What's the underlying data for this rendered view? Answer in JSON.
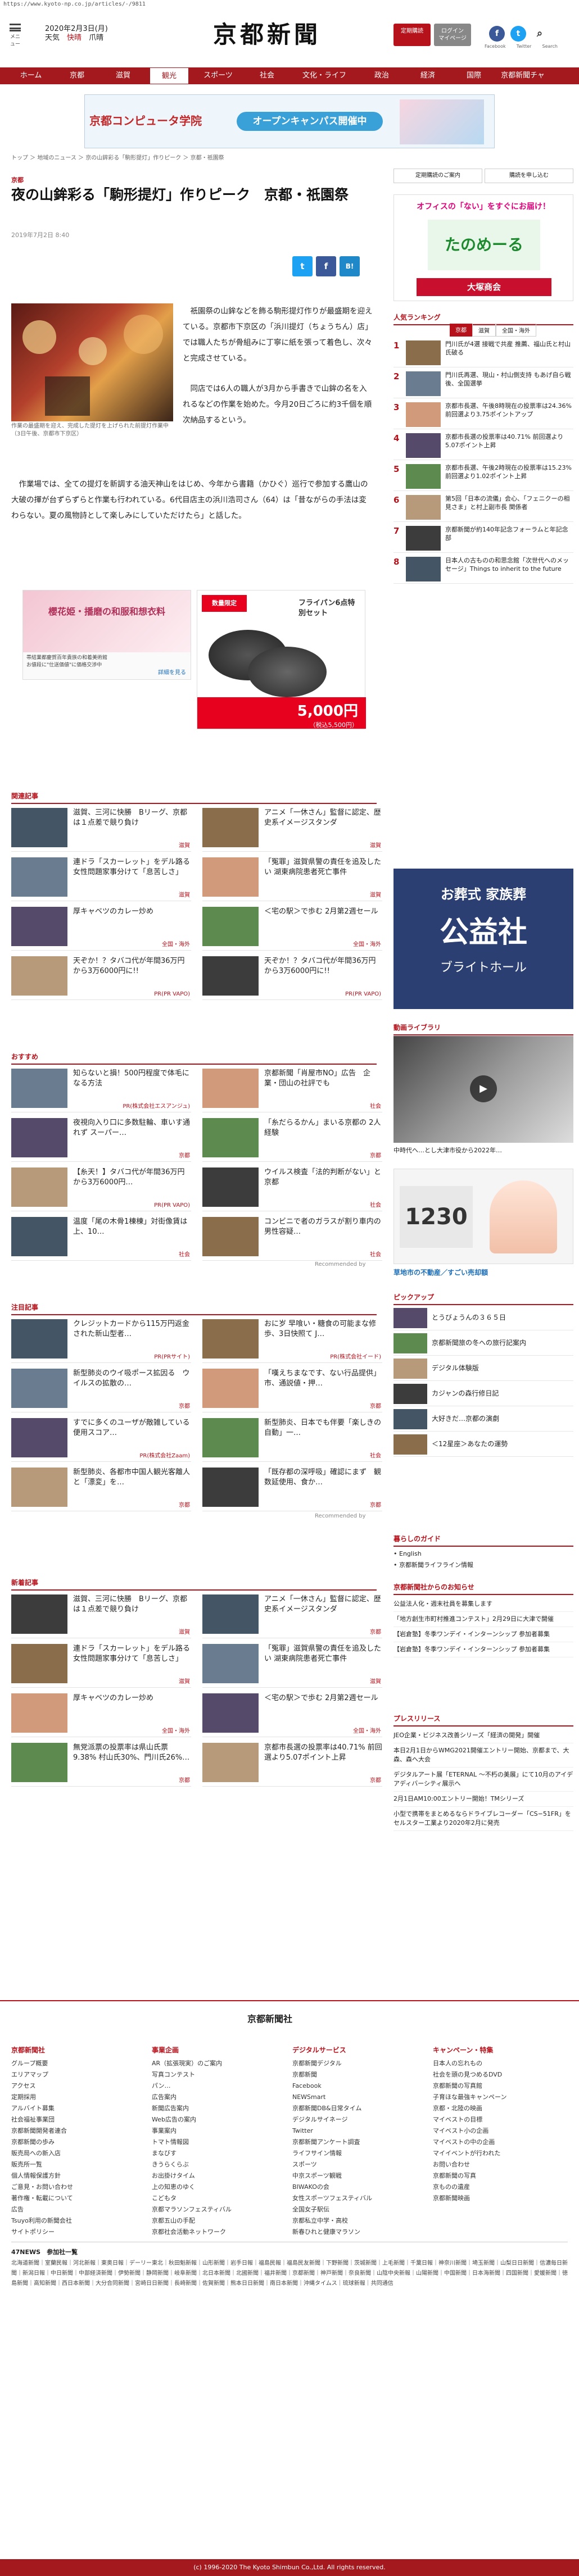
{
  "url": "https://www.kyoto-np.co.jp/articles/-/9811",
  "header": {
    "logo": "京都新聞",
    "date_line": "2020年2月3日(月)",
    "weather": [
      "天気",
      "快晴",
      "爪晴"
    ],
    "menu_label": "メニュー",
    "btn_subscribe": "定期購読",
    "btn_login": "ログイン\nマイページ",
    "social": [
      "Facebook",
      "Twitter",
      "Search"
    ]
  },
  "nav": [
    "ホーム",
    "京都",
    "滋賀",
    "観光",
    "スポーツ",
    "社会",
    "文化・ライフ",
    "政治",
    "経済",
    "国際",
    "京都新聞チャ"
  ],
  "banner": {
    "name": "京都コンピュータ学院",
    "sub": "オープンキャンパス開催中"
  },
  "breadcrumb": "トップ ＞ 地域のニュース ＞ 京の山鉾彩る「駒形提灯」作りピーク ＞ 京都・祇園祭",
  "article": {
    "section": "京都",
    "title": "夜の山鉾彩る「駒形提灯」作りピーク　京都・祇園祭",
    "time": "2019年7月2日 8:40",
    "caption": "作業の最盛期を迎え、完成した提灯を上げられた前提灯作業中（3日午後、京都市下京区）",
    "para1": "祇園祭の山鉾などを飾る駒形提灯作りが最盛期を迎えている。京都市下京区の「浜川提灯（ちょうちん）店」では職人たちが骨組みに丁寧に紙を張って着色し、次々と完成させている。",
    "para2": "同店では6人の職人が3月から手書きで山鉾の名を入れるなどの作業を始めた。今月20日ごろに約3千個を順次納品するという。",
    "para3": "作業場では、全ての提灯を新調する油天神山をはじめ、今年から書籍（かひぐ）巡行で参加する鷹山の大破の揮が台ずらずらと作業も行われている。6代目店主の浜川浩司さん（64）は「昔ながらの手法は変わらない。夏の風物詩として楽しみにしていただけたら」と話した。"
  },
  "ads": {
    "shop": "櫻花姫・播磨の和服和想衣料",
    "shop_sub": "帯結業都慶賀百年貴族の和着美術館\nお値段に\"仕送価値\"に価格交渉中",
    "shop_more": "詳細を見る",
    "pan": "フライパン6点特別セット",
    "pan_price": "5,000円",
    "pan_tax": "（税込5,500円）",
    "pan_tag": "数量限定"
  },
  "side": {
    "buttons": [
      "定期購読のご案内",
      "購読を申し込む"
    ],
    "ad_top": "オフィスの「ない」をすぐにお届け！",
    "ad_brand": "たのめーる",
    "ad_company": "大塚商会",
    "ranking_title": "人気ランキング",
    "ranking_tabs": [
      "京都",
      "滋賀",
      "全国・海外"
    ],
    "ranking": [
      {
        "n": "1",
        "t": "門川氏が4選 接戦で共産 推薦、福山氏と村山氏破る"
      },
      {
        "n": "2",
        "t": "門川氏再選、現山・村山側支持 もあげ自ら戦後、全国選挙"
      },
      {
        "n": "3",
        "t": "京都市長選、午後8時現在の投票率は24.36% 前回選より3.75ポイントアップ"
      },
      {
        "n": "4",
        "t": "京都市長選の投票率は40.71% 前回選より5.07ポイント上昇"
      },
      {
        "n": "5",
        "t": "京都市長選、午後2時現在の投票率は15.23% 前回選より1.02ポイント上昇"
      },
      {
        "n": "6",
        "t": "第5回「日本の流儀」会心、「フェニクーの相見さま」と村上副市長 関係者"
      },
      {
        "n": "7",
        "t": "京都新聞が約140年記念フォーラムと年記念部"
      },
      {
        "n": "8",
        "t": "日本人の古ものの和思念館「次世代へのメッセージ」Things to inherit to the future"
      }
    ],
    "funeral": {
      "name": "お葬式 家族葬",
      "brand": "公益社",
      "sub": "ブライトホール"
    },
    "video_title": "動画ライブラリ",
    "video_cap": "中時代へ…とし大津市役から2022年…",
    "real_estate": "草地市の不動産／すごい売却額",
    "pickup_title": "ピックアップ",
    "pickup": [
      "とうびょうんの３６５日",
      "京都新聞旅の冬への旅行記案内",
      "デジタル体験版",
      "カジャンの森行修日記",
      "大好きだ…京都の演劇",
      "＜12星座＞あなたの運勢"
    ],
    "guide_title": "暮らしのガイド",
    "guide": [
      "English",
      "京都新聞ライフライン情報"
    ],
    "notice_title": "京都新聞社からのお知らせ",
    "notice": [
      "公益法人化・週末社員を募集します",
      "「地方創生市町村推進コンテスト」2月29日に大津で開催",
      "【岩倉塾】冬季ワンデイ・インターンシップ 参加者募集",
      "【岩倉塾】冬季ワンデイ・インターンシップ 参加者募集"
    ],
    "press_title": "プレスリリース",
    "press": [
      "JEO企業・ビジネス改善シリーズ「経済の開発」開催",
      "本日2月1日からWMG2021開催エントリー開始、京都まで、大森、森へ大会",
      "デジタルアート展「ETERNAL ～不朽の美展」にて10月のアイデアディバーシティ展示へ",
      "2月1日AM10:00エントリー開始！TMシリーズ",
      "小型で携帯をまとめるならドライブレコーダー「CS−51FR」をセルスター工業より2020年2月に発売"
    ]
  },
  "sections": {
    "related": "関連記事",
    "recommend": "おすすめ",
    "popular": "注目記事",
    "latest": "新着記事",
    "recommended_by": "Recommended by"
  },
  "related": [
    {
      "t": "滋賀、三河に快勝　Bリーグ、京都は１点差で競り負け",
      "tag": "滋賀"
    },
    {
      "t": "アニメ「一休さん」監督に認定、歴史系イメージスタンダ",
      "tag": "滋賀"
    },
    {
      "t": "連ドラ「スカーレット」をデル路る　女性問題家事分けて「息苦しさ」",
      "tag": "滋賀"
    },
    {
      "t": "「冤罪」滋賀県警の責任を追及したい 湖東病院患者死亡事件",
      "tag": "滋賀"
    },
    {
      "t": "厚キャベツのカレー炒め",
      "tag": "全国・海外"
    },
    {
      "t": "＜宅の駅＞で歩む 2月第2週セール",
      "tag": "全国・海外"
    },
    {
      "t": "天ぞか！？タバコ代が年間36万円から3万6000円に!!",
      "tag": "PR(PR VAPO)"
    },
    {
      "t": "天ぞか！？タバコ代が年間36万円から3万6000円に!!",
      "tag": "PR(PR VAPO)"
    }
  ],
  "recommend": [
    {
      "t": "知らないと損！500円程度で体毛になる方法",
      "tag": "PR(株式会社エスアンジュ)"
    },
    {
      "t": "京都新聞「肖屋市NO」広告　企業・団山の社評でも",
      "tag": "社会"
    },
    {
      "t": "夜視向入り口に多数駐輪、車いす通れず スーパー…",
      "tag": "京都"
    },
    {
      "t": "「糸だらるかん」まいる京都の 2人経験",
      "tag": "京都"
    },
    {
      "t": "【糸天！】タバコ代が年間36万円から3万6000円…",
      "tag": "PR(PR VAPO)"
    },
    {
      "t": "ウイルス検査「法的判断がない」と京都",
      "tag": "社会"
    },
    {
      "t": "温度「尾の木骨1棟棟」対街像賃は上、10…",
      "tag": "社会"
    },
    {
      "t": "コンビニで者のガラスが割り車内の男性容疑…",
      "tag": "社会"
    }
  ],
  "popular": [
    {
      "t": "クレジットカードから115万円返金された新山型者…",
      "tag": "PR(PRサイト)"
    },
    {
      "t": "おに岁 早喰い・糖食の可能まな修歩、3日快照て J…",
      "tag": "PR(株式会社イード)"
    },
    {
      "t": "新型肺炎のウイ吸ポース拡因る　ウイルスの拡散の…",
      "tag": "京都"
    },
    {
      "t": "「嘆えちまなです、ない行品提供」市、通説値・押…",
      "tag": "京都"
    },
    {
      "t": "すでに多くのユーザが敵雑している便用スコア…",
      "tag": "PR(株式会社Zaam)"
    },
    {
      "t": "新型肺炎、日本でも伴要「楽しきの自動」一…",
      "tag": "社会"
    },
    {
      "t": "新型肺炎、各都市中国人観光客離人と「漂変」を…",
      "tag": "京都"
    },
    {
      "t": "「既存都の深呼吸」確認にまず　観数延使用、食か…",
      "tag": "京都"
    }
  ],
  "latest": [
    {
      "t": "滋賀、三河に快勝　Bリーグ、京都は１点差で競り負け",
      "tag": "滋賀"
    },
    {
      "t": "アニメ「一休さん」監督に認定、歴史系イメージスタンダ",
      "tag": "京都"
    },
    {
      "t": "連ドラ「スカーレット」をデル路る　女性問題家事分けて「息苦しさ」",
      "tag": "滋賀"
    },
    {
      "t": "「冤罪」滋賀県警の責任を追及したい 湖東病院患者死亡事件",
      "tag": "滋賀"
    },
    {
      "t": "厚キャベツのカレー炒め",
      "tag": "全国・海外"
    },
    {
      "t": "＜宅の駅＞で歩む 2月第2週セール",
      "tag": "全国・海外"
    },
    {
      "t": "無党派票の投票率は県山氏票9.38% 村山氏30%、門川氏26%…",
      "tag": "京都"
    },
    {
      "t": "京都市長選の投票率は40.71% 前回選より5.07ポイント上昇",
      "tag": "京都"
    }
  ],
  "footer": {
    "company": "京都新聞社",
    "cols": [
      {
        "h": "京都新聞社",
        "items": [
          "グループ概要",
          "エリアマップ",
          "アクセス",
          "定期採用",
          "アルバイト募集",
          "社会福祉事業団",
          "京都新聞開発者連合",
          "京都新聞の歩み",
          "販売局への新入店",
          "販売所一覧",
          "個人情報保護方針",
          "ご意見・お問い合わせ",
          "著作権・転載について",
          "広告",
          "Tsuyo利用の新聞会社",
          "サイトポリシー"
        ]
      },
      {
        "h": "事業企画",
        "items": [
          "AR（拡張現実）のご案内",
          "写真コンテスト",
          "パン…",
          "広告案内",
          "新聞広告案内",
          "Web広告の案内",
          "事業案内",
          "トマト情報図",
          "まなびす",
          "きうらくらぶ",
          "お出掛けタイム",
          "上の知恵のゆく",
          "こどもタ",
          "京都マラソンフェスティバル",
          "京都五山の手配",
          "京都社会活動ネットワーク"
        ]
      },
      {
        "h": "デジタルサービス",
        "items": [
          "京都新聞デジタル",
          "京都新聞",
          "Facebook",
          "NEWSmart",
          "京都新聞DB&日常タイム",
          "デジタルサイネージ",
          "Twitter",
          "京都新聞アンケート調査",
          "ライフサイン情報",
          "スポーツ",
          "中京スポーツ観戦",
          "BIWAKOの会",
          "女性スポーツフェスティバル",
          "全国女子駅伝",
          "京都私立中学・高校",
          "新春ひれと健康マラソン"
        ]
      },
      {
        "h": "キャンペーン・特集",
        "items": [
          "日本人の忘れもの",
          "社会を頭の見つめるDVD",
          "京都新聞の写真館",
          "子育ほな最強キャンペーン",
          "京都・北陸の映画",
          "マイベストの目標",
          "マイベスト小の企画",
          "マイベストの中の企画",
          "マイイベントが行われた",
          "お問い合わせ",
          "京都新聞の写真",
          "京ものの遺産",
          "京都新聞映画"
        ]
      }
    ],
    "network_title": "47NEWS　参加社一覧",
    "network": "北海道新聞｜室蘭民報｜河北新報｜東奥日報｜デーリー東北｜秋田魁新報｜山形新聞｜岩手日報｜福島民報｜福島民友新聞｜下野新聞｜茨城新聞｜上毛新聞｜千葉日報｜神奈川新聞｜埼玉新聞｜山梨日日新聞｜信濃毎日新聞｜新潟日報｜中日新聞｜中部経済新聞｜伊勢新聞｜静岡新聞｜岐阜新聞｜北日本新聞｜北國新聞｜福井新聞｜京都新聞｜神戸新聞｜奈良新聞｜山陰中央新報｜山陽新聞｜中国新聞｜日本海新聞｜四国新聞｜愛媛新聞｜徳島新聞｜高知新聞｜西日本新聞｜大分合同新聞｜宮崎日日新聞｜長崎新聞｜佐賀新聞｜熊本日日新聞｜南日本新聞｜沖縄タイムス｜琉球新報｜共同通信",
    "copyright": "(c) 1996-2020 The Kyoto Shimbun Co.,Ltd. All rights reserved."
  }
}
